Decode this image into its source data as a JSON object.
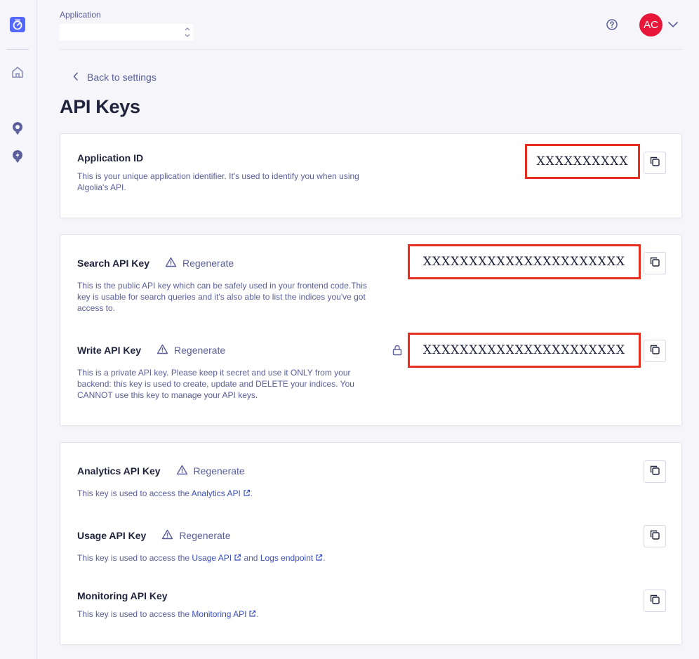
{
  "header": {
    "app_label": "Application",
    "app_value": "",
    "avatar_initials": "AC",
    "avatar_color": "#e8173a"
  },
  "nav": {
    "back_label": "Back to settings"
  },
  "page": {
    "title": "API Keys"
  },
  "app_id_card": {
    "title": "Application ID",
    "description": "This is your unique application identifier. It's used to identify you when using Algolia's API.",
    "value": "XXXXXXXXXX"
  },
  "primary_keys_card": {
    "search": {
      "title": "Search API Key",
      "regenerate": "Regenerate",
      "description": "This is the public API key which can be safely used in your frontend code.This key is usable for search queries and it's also able to list the indices you've got access to.",
      "value": "XXXXXXXXXXXXXXXXXXXXXX"
    },
    "write": {
      "title": "Write API Key",
      "regenerate": "Regenerate",
      "description": "This is a private API key. Please keep it secret and use it ONLY from your backend: this key is used to create, update and DELETE your indices. You CANNOT use this key to manage your API keys.",
      "value": "XXXXXXXXXXXXXXXXXXXXXX"
    }
  },
  "other_keys_card": {
    "analytics": {
      "title": "Analytics API Key",
      "regenerate": "Regenerate",
      "desc_prefix": "This key is used to access the ",
      "link1": "Analytics API",
      "desc_suffix": "."
    },
    "usage": {
      "title": "Usage API Key",
      "regenerate": "Regenerate",
      "desc_prefix": "This key is used to access the ",
      "link1": "Usage API",
      "desc_middle": " and ",
      "link2": "Logs endpoint",
      "desc_suffix": "."
    },
    "monitoring": {
      "title": "Monitoring API Key",
      "desc_prefix": "This key is used to access the ",
      "link1": "Monitoring API",
      "desc_suffix": "."
    }
  },
  "colors": {
    "accent": "#5468ff",
    "highlight_border": "#e5301f",
    "text_muted": "#5a5e9a",
    "link": "#3a4fc0"
  }
}
